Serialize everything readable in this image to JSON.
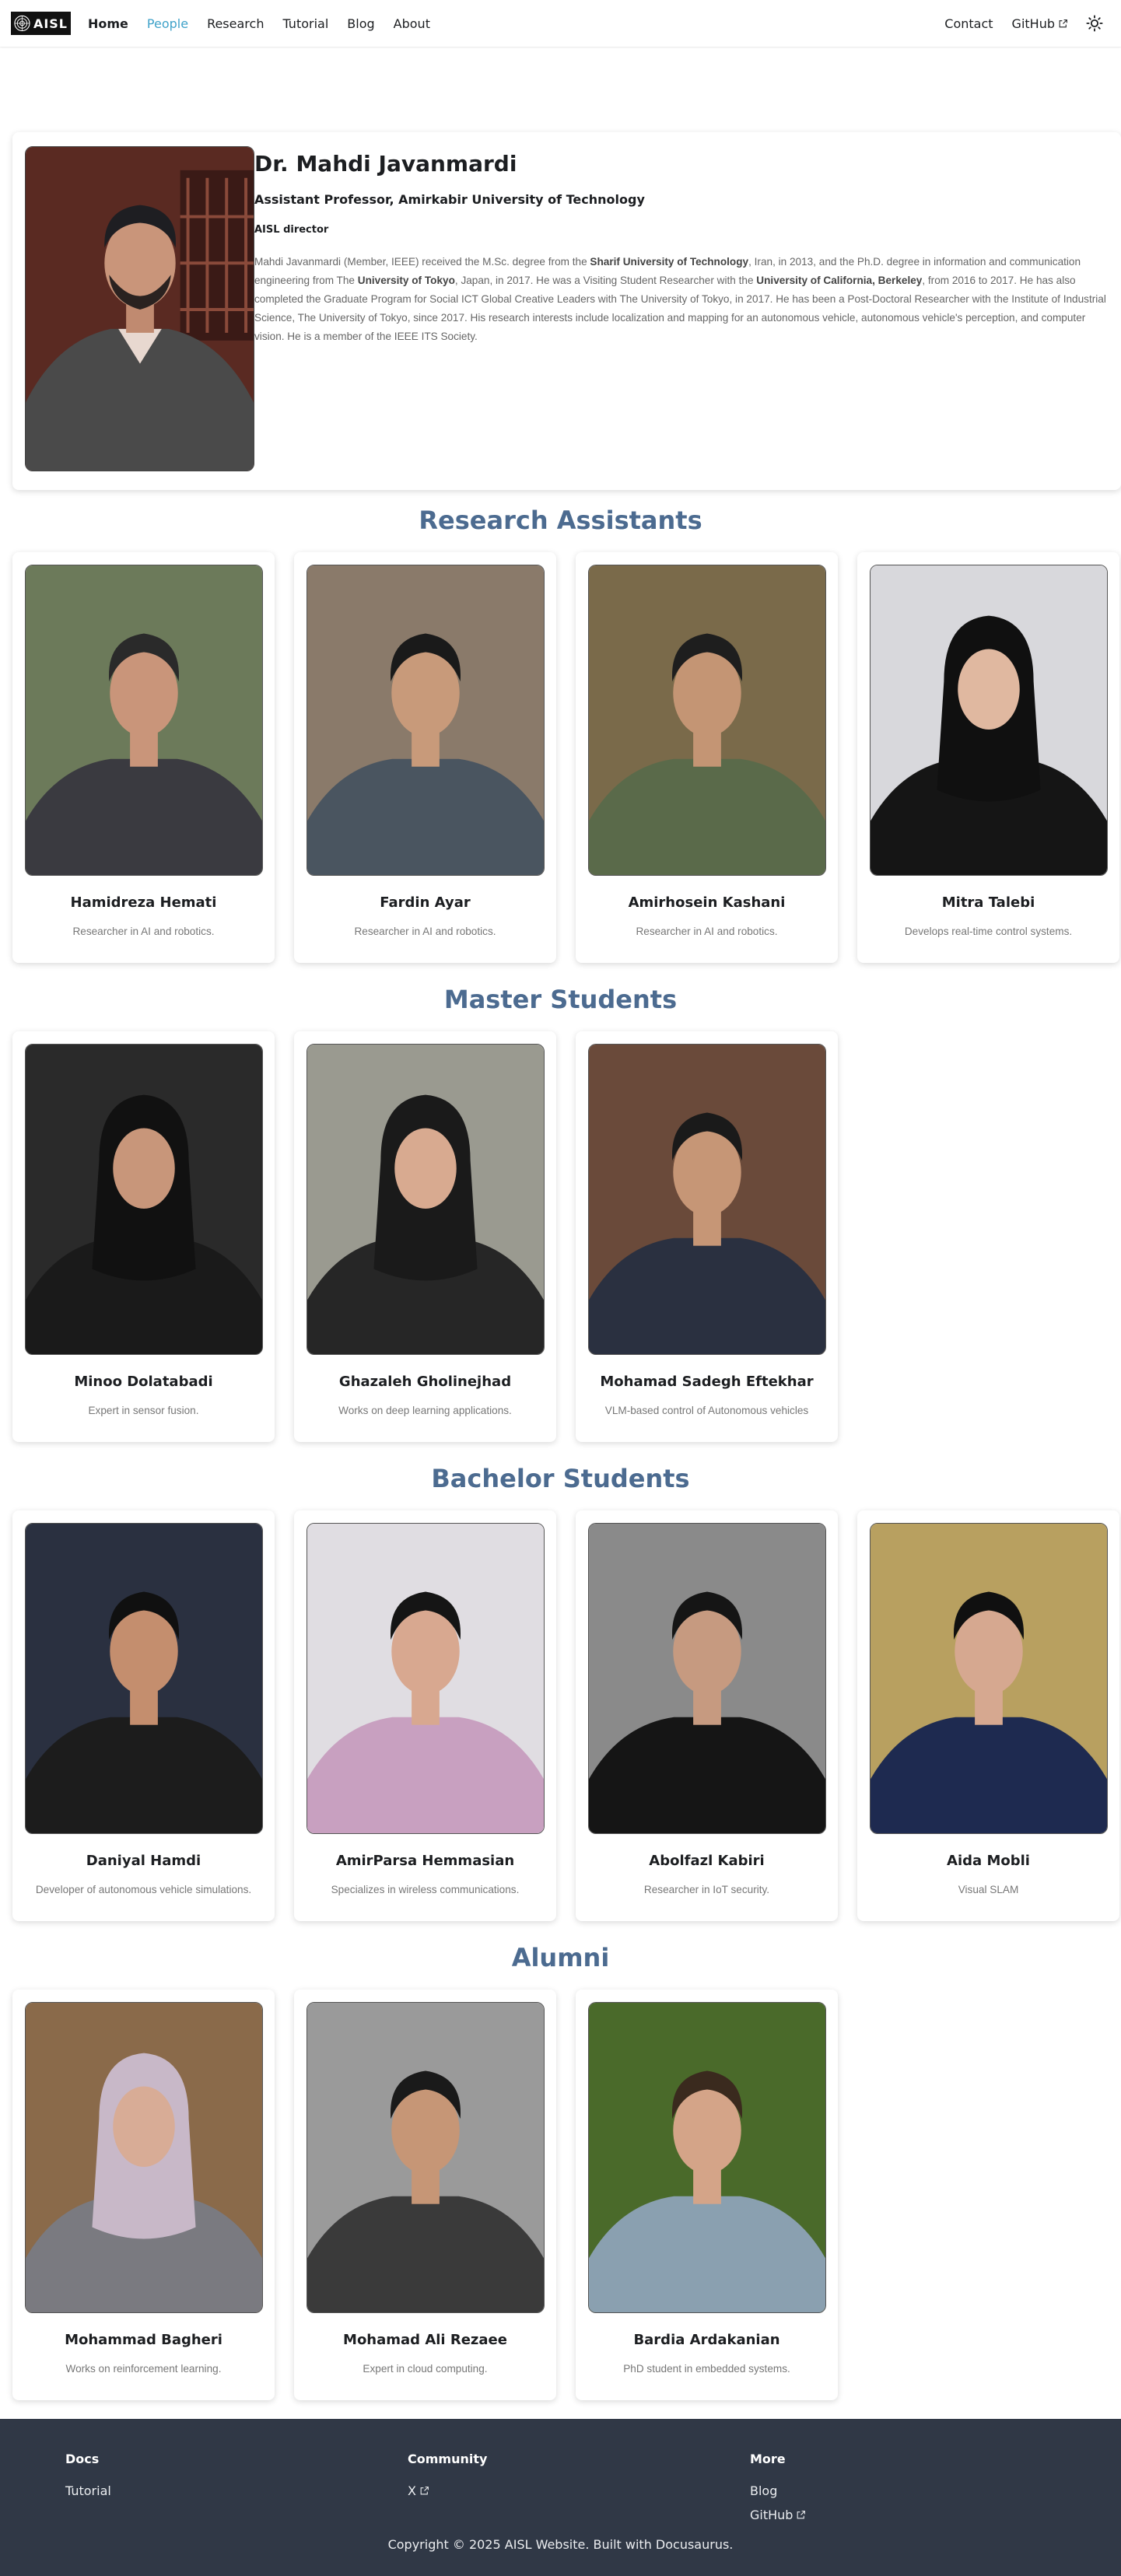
{
  "navbar": {
    "logo_text": "AISL",
    "links": [
      "Home",
      "People",
      "Research",
      "Tutorial",
      "Blog",
      "About"
    ],
    "right_links": [
      "Contact",
      "GitHub"
    ],
    "active": "People",
    "accent_color": "#3fa2c9"
  },
  "director": {
    "name": "Dr. Mahdi Javanmardi",
    "title": "Assistant Professor, Amirkabir University of Technology",
    "role": "AISL director",
    "bio_1": "Mahdi Javanmardi (Member, IEEE) received the M.Sc. degree from the ",
    "bio_b1": "Sharif University of Technology",
    "bio_2": ", Iran, in 2013, and the Ph.D. degree in information and communication engineering from The ",
    "bio_b2": "University of Tokyo",
    "bio_3": ", Japan, in 2017. He was a Visiting Student Researcher with the ",
    "bio_b3": "University of California, Berkeley",
    "bio_4": ", from 2016 to 2017. He has also completed the Graduate Program for Social ICT Global Creative Leaders with The University of Tokyo, in 2017. He has been a Post-Doctoral Researcher with the Institute of Industrial Science, The University of Tokyo, since 2017. His research interests include localization and mapping for an autonomous vehicle, autonomous vehicle's perception, and computer vision. He is a member of the IEEE ITS Society."
  },
  "sections": {
    "research_assistants": "Research Assistants",
    "master_students": "Master Students",
    "bachelor_students": "Bachelor Students",
    "alumni": "Alumni"
  },
  "research_assistants": [
    {
      "name": "Hamidreza Hemati",
      "desc": "Researcher in AI and robotics."
    },
    {
      "name": "Fardin Ayar",
      "desc": "Researcher in AI and robotics."
    },
    {
      "name": "Amirhosein Kashani",
      "desc": "Researcher in AI and robotics."
    },
    {
      "name": "Mitra Talebi",
      "desc": "Develops real-time control systems."
    }
  ],
  "master_students": [
    {
      "name": "Minoo Dolatabadi",
      "desc": "Expert in sensor fusion."
    },
    {
      "name": "Ghazaleh Gholinejhad",
      "desc": "Works on deep learning applications."
    },
    {
      "name": "Mohamad Sadegh Eftekhar",
      "desc": "VLM-based control of Autonomous vehicles"
    }
  ],
  "bachelor_students": [
    {
      "name": "Daniyal Hamdi",
      "desc": "Developer of autonomous vehicle simulations."
    },
    {
      "name": "AmirParsa Hemmasian",
      "desc": "Specializes in wireless communications."
    },
    {
      "name": "Abolfazl Kabiri",
      "desc": "Researcher in IoT security."
    },
    {
      "name": "Aida Mobli",
      "desc": "Visual SLAM"
    }
  ],
  "alumni": [
    {
      "name": "Mohammad Bagheri",
      "desc": "Works on reinforcement learning."
    },
    {
      "name": "Mohamad Ali Rezaee",
      "desc": "Expert in cloud computing."
    },
    {
      "name": "Bardia Ardakanian",
      "desc": "PhD student in embedded systems."
    }
  ],
  "footer": {
    "docs_head": "Docs",
    "docs_links": [
      "Tutorial"
    ],
    "community_head": "Community",
    "community_links": [
      "X"
    ],
    "more_head": "More",
    "more_links": [
      "Blog",
      "GitHub"
    ],
    "copyright": "Copyright © 2025 AISL Website. Built with Docusaurus.",
    "bg_color": "#303846"
  },
  "icons": [
    "logo-mark-icon",
    "external-link-icon",
    "theme-toggle-sun-icon"
  ]
}
